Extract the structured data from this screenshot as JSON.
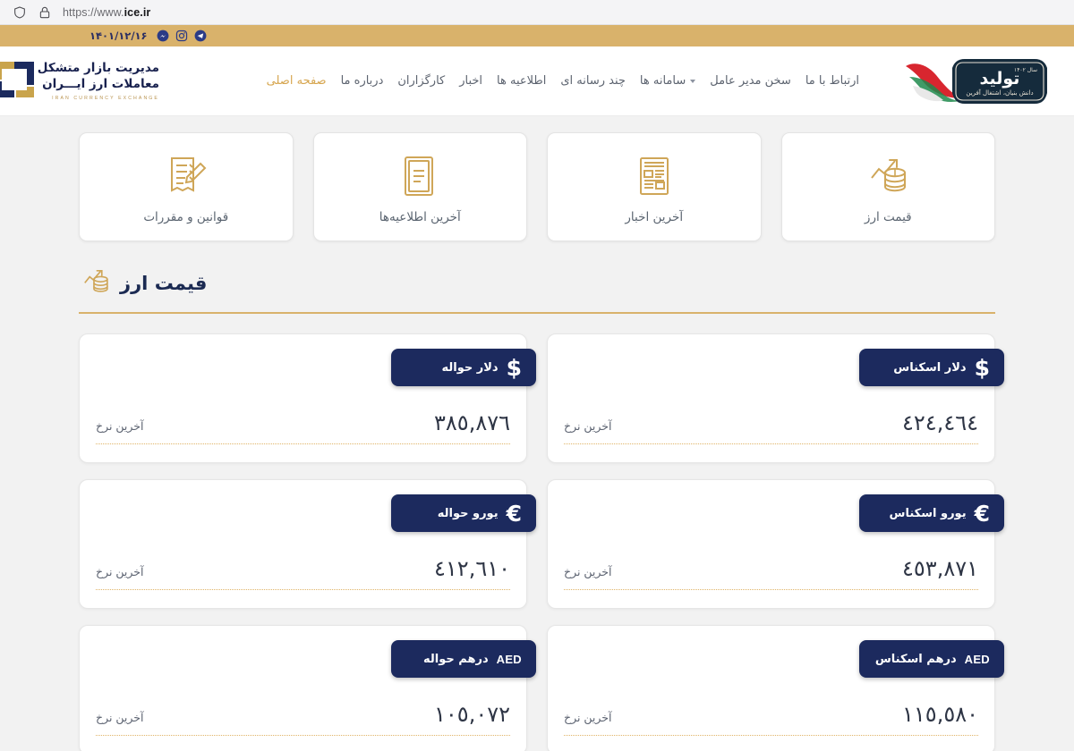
{
  "browser": {
    "url_prefix": "https://www.",
    "url_domain": "ice.ir",
    "shield_icon": "shield-icon",
    "lock_icon": "lock-icon"
  },
  "topbar": {
    "date": "۱۴۰۱/۱۲/۱۶",
    "socials": [
      {
        "name": "messenger-icon",
        "label": "Messenger"
      },
      {
        "name": "instagram-icon",
        "label": "Instagram"
      },
      {
        "name": "telegram-icon",
        "label": "Telegram"
      }
    ],
    "background": "#d9b26b"
  },
  "header": {
    "brand": {
      "line1": "مدیریت بازار متشکل",
      "line2": "معاملات ارز ایـــران",
      "subtitle": "IRAN CURRENCY EXCHANGE",
      "navy": "#18214e",
      "gold": "#b9934f"
    },
    "year_logo": {
      "title": "تولید",
      "subtitle": "دانش بنیان، اشتغال آفرین",
      "year": "سال ۱۴۰۲"
    },
    "nav": [
      {
        "label": "صفحه اصلی",
        "active": true,
        "dropdown": false
      },
      {
        "label": "درباره ما",
        "active": false,
        "dropdown": false
      },
      {
        "label": "کارگزاران",
        "active": false,
        "dropdown": false
      },
      {
        "label": "اخبار",
        "active": false,
        "dropdown": false
      },
      {
        "label": "اطلاعیه ها",
        "active": false,
        "dropdown": false
      },
      {
        "label": "چند رسانه ای",
        "active": false,
        "dropdown": false
      },
      {
        "label": "سامانه ها",
        "active": false,
        "dropdown": true
      },
      {
        "label": "سخن مدیر عامل",
        "active": false,
        "dropdown": false
      },
      {
        "label": "ارتباط با ما",
        "active": false,
        "dropdown": false
      }
    ]
  },
  "quick_links": [
    {
      "label": "قوانین و مقررات",
      "icon": "rules-document-pencil-icon"
    },
    {
      "label": "آخرین اطلاعیه‌ها",
      "icon": "announcement-document-icon"
    },
    {
      "label": "آخرین اخبار",
      "icon": "newspaper-icon"
    },
    {
      "label": "قیمت ارز",
      "icon": "coins-trend-icon"
    }
  ],
  "currency_section": {
    "title": "قیمت ارز",
    "icon": "coins-trend-icon",
    "rule_color": "#d9b26b",
    "rate_label": "آخرین نرخ",
    "cards": [
      {
        "name": "دلار اسکناس",
        "symbol": "$",
        "symbol_type": "glyph",
        "value": "٤٢٤,٤٦٤",
        "value_latin": "424,464"
      },
      {
        "name": "دلار حواله",
        "symbol": "$",
        "symbol_type": "glyph",
        "value": "٣٨٥,٨٧٦",
        "value_latin": "385,876"
      },
      {
        "name": "یورو اسکناس",
        "symbol": "€",
        "symbol_type": "glyph",
        "value": "٤٥٣,٨٧١",
        "value_latin": "453,871"
      },
      {
        "name": "یورو حواله",
        "symbol": "€",
        "symbol_type": "glyph",
        "value": "٤١٢,٦١٠",
        "value_latin": "412,610"
      },
      {
        "name": "درهم اسکناس",
        "symbol": "AED",
        "symbol_type": "text",
        "value": "١١٥,٥٨٠",
        "value_latin": "115,580"
      },
      {
        "name": "درهم حواله",
        "symbol": "AED",
        "symbol_type": "text",
        "value": "١٠٥,٠٧٢",
        "value_latin": "105,072"
      }
    ]
  }
}
